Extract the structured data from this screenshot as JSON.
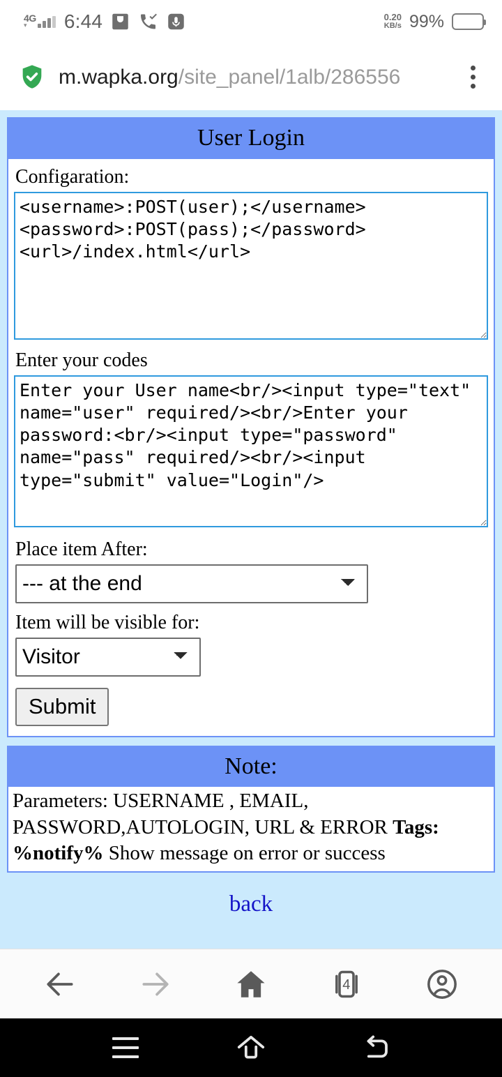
{
  "status_bar": {
    "network_type": "4G",
    "time": "6:44",
    "data_speed_value": "0.20",
    "data_speed_unit": "KB/s",
    "battery_percent": "99%",
    "icons": [
      "signal-icon",
      "message-icon",
      "missed-call-icon",
      "microphone-icon",
      "battery-icon"
    ]
  },
  "browser": {
    "url_host": "m.wapka.org",
    "url_path": "/site_panel/1alb/286556",
    "secure_icon": "shield-check-icon",
    "menu_icon": "overflow-menu-icon",
    "nav": {
      "back_label": "back-arrow-icon",
      "forward_label": "forward-arrow-icon",
      "home_label": "home-icon",
      "tabs_label": "tabs-icon",
      "tab_count": "4",
      "profile_label": "account-icon"
    }
  },
  "page": {
    "login_panel": {
      "title": "User Login",
      "config_label": "Configaration:",
      "config_value": "<username>:POST(user);</username>\n<password>:POST(pass);</password>\n<url>/index.html</url>",
      "config_placeholder": "",
      "codes_label": "Enter your codes",
      "codes_value": "Enter your User name<br/><input type=\"text\" name=\"user\" required/><br/>Enter your password:<br/><input type=\"password\" name=\"pass\" required/><br/><input type=\"submit\" value=\"Login\"/>",
      "codes_placeholder": "",
      "place_label": "Place item After:",
      "place_selected": "--- at the end",
      "place_options": [
        "--- at the end"
      ],
      "visible_label": "Item will be visible for:",
      "visible_selected": "Visitor",
      "visible_options": [
        "Visitor"
      ],
      "submit_label": "Submit"
    },
    "note_panel": {
      "title": "Note:",
      "line1": "Parameters: USERNAME , EMAIL, PASSWORD,AUTOLOGIN, URL & ERROR",
      "tags_bold": "Tags: %notify%",
      "tags_rest": " Show message on error or success"
    },
    "back_link": "back"
  },
  "system_nav": {
    "menu_label": "menu-icon",
    "home_label": "home-icon",
    "back_label": "back-icon"
  },
  "colors": {
    "header_blue": "#6c92f6",
    "page_background": "#cbeafd",
    "textarea_border": "#2f9ade",
    "link_blue": "#1414c8",
    "shield_green": "#34a853"
  }
}
